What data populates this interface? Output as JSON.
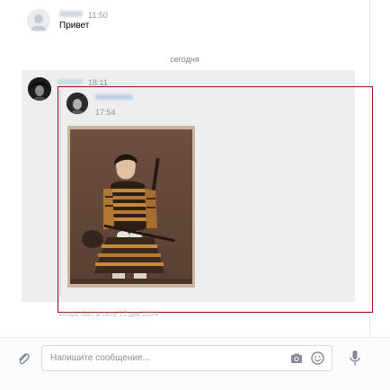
{
  "messages": [
    {
      "time": "11:50",
      "text": "Привет"
    }
  ],
  "date_separator": "сегодня",
  "forward_message": {
    "time": "18:11",
    "forwarded": {
      "time": "17:54",
      "image": "samurai-photo"
    }
  },
  "status_line": "Игорь был в сети 17 дек 2014",
  "composer": {
    "placeholder": "Напишите сообщение..."
  },
  "icons": {
    "attach": "paperclip-icon",
    "camera": "camera-icon",
    "emoji": "smile-icon",
    "voice": "microphone-icon"
  },
  "colors": {
    "selection_bg": "#edeef0",
    "highlight_border": "#9b0b0b",
    "icon_gray": "#828a99"
  }
}
